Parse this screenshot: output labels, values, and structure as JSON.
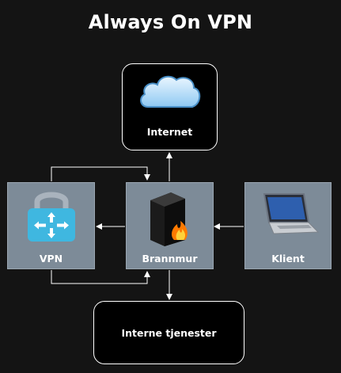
{
  "title": "Always On VPN",
  "nodes": {
    "internet": {
      "label": "Internet",
      "icon": "cloud-icon"
    },
    "vpn": {
      "label": "VPN",
      "icon": "vpn-lock-icon"
    },
    "firewall": {
      "label": "Brannmur",
      "icon": "firewall-icon"
    },
    "client": {
      "label": "Klient",
      "icon": "laptop-icon"
    },
    "internal": {
      "label": "Interne tjenester"
    }
  },
  "colors": {
    "background": "#141414",
    "node_fill": "#7d8b98",
    "vpn_accent": "#3fb7e0",
    "lines": "#ffffff"
  }
}
